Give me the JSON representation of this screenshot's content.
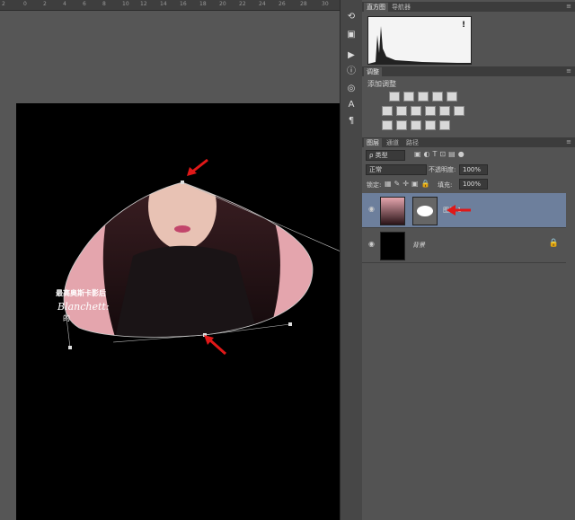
{
  "ruler": {
    "ticks": [
      "2",
      "0",
      "2",
      "4",
      "6",
      "8",
      "10",
      "12",
      "14",
      "16",
      "18",
      "20",
      "22",
      "24",
      "26",
      "28",
      "30"
    ]
  },
  "document": {
    "overlay_text_1": "最高奥斯卡影后",
    "overlay_text_2": "Blanchett:",
    "overlay_text_3": "的"
  },
  "toolbar": {
    "icons": [
      "history-icon",
      "actions-icon",
      "play-icon",
      "info-icon",
      "adjust-icon",
      "character-icon",
      "paragraph-icon"
    ]
  },
  "histogram_panel": {
    "tabs": [
      "直方图",
      "导航器"
    ],
    "warning": "!"
  },
  "adjustments_panel": {
    "tab": "调整",
    "title": "添加调整"
  },
  "layers_panel": {
    "tabs": [
      "图层",
      "通道",
      "路径"
    ],
    "filter_label": "ρ 类型",
    "blend_mode": "正常",
    "opacity_label": "不透明度:",
    "opacity_value": "100%",
    "lock_label": "锁定:",
    "fill_label": "填充:",
    "fill_value": "100%",
    "layers": [
      {
        "name": "图层 1",
        "selected": true
      },
      {
        "name": "背景",
        "selected": false
      }
    ]
  },
  "colors": {
    "accent_selected_layer": "#6d7f9c",
    "arrow": "#e01818",
    "panel_bg": "#535353"
  }
}
